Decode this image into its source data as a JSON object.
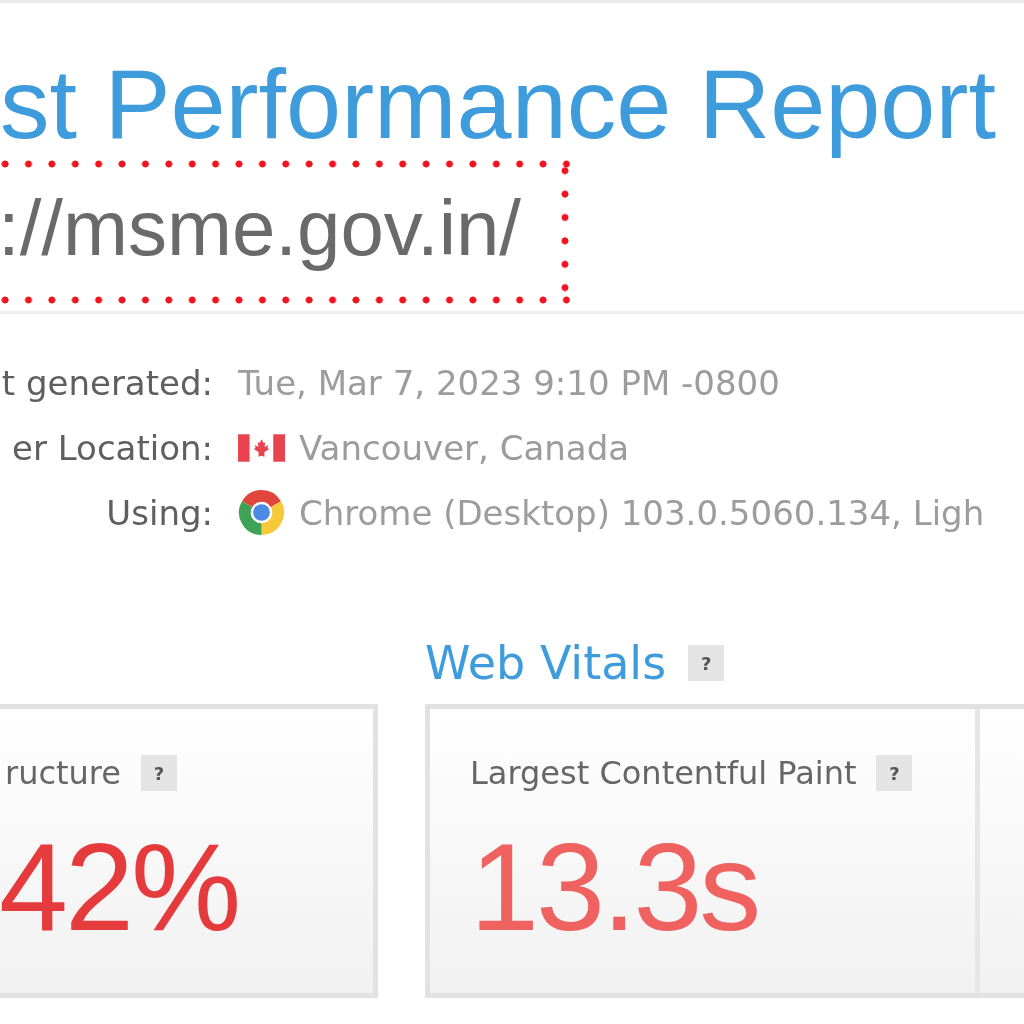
{
  "title": "st Performance Report",
  "url": "://msme.gov.in/",
  "details": [
    {
      "label": "t generated:",
      "value": "Tue, Mar 7, 2023 9:10 PM -0800",
      "kind": "text"
    },
    {
      "label": "er Location:",
      "value": "Vancouver, Canada",
      "kind": "flag"
    },
    {
      "label": "Using:",
      "value": "Chrome (Desktop) 103.0.5060.134, Ligh",
      "kind": "browser"
    }
  ],
  "structure_card": {
    "label": "ructure",
    "help": "?",
    "value": "42%"
  },
  "web_vitals": {
    "heading": "Web Vitals",
    "help": "?",
    "metrics": [
      {
        "label": "Largest Contentful Paint",
        "help": "?",
        "value": "13.3s"
      }
    ]
  }
}
